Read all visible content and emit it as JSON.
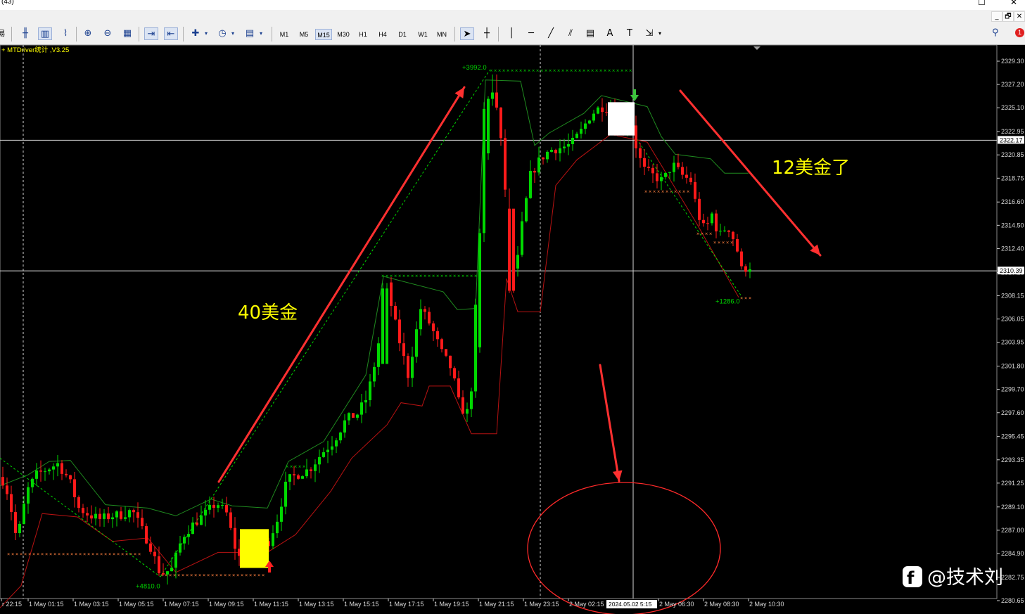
{
  "window": {
    "title": "(43)",
    "buttons": {
      "minimize": "–",
      "maximize": "☐",
      "close": "✕"
    }
  },
  "menubar": {
    "min_btn": "_",
    "restore_btn": "🗗",
    "close_btn": "✕",
    "left_glyph": "易"
  },
  "toolbar": {
    "icons": [
      {
        "name": "bar-chart-icon",
        "glyph": "╫"
      },
      {
        "name": "candlestick-icon",
        "glyph": "▥"
      },
      {
        "name": "line-chart-icon",
        "glyph": "⌇"
      },
      {
        "name": "zoom-in-icon",
        "glyph": "⊕"
      },
      {
        "name": "zoom-out-icon",
        "glyph": "⊖"
      },
      {
        "name": "tile-windows-icon",
        "glyph": "▦"
      },
      {
        "name": "auto-scroll-icon",
        "glyph": "⇥"
      },
      {
        "name": "chart-shift-icon",
        "glyph": "⇤"
      },
      {
        "name": "indicators-icon",
        "glyph": "✚"
      },
      {
        "name": "periods-clock-icon",
        "glyph": "◷"
      },
      {
        "name": "templates-icon",
        "glyph": "▤"
      }
    ],
    "timeframes": [
      "M1",
      "M5",
      "M15",
      "M30",
      "H1",
      "H4",
      "D1",
      "W1",
      "MN"
    ],
    "active_timeframe": "M15",
    "draw_tools": [
      {
        "name": "cursor-icon",
        "glyph": "➤"
      },
      {
        "name": "crosshair-icon",
        "glyph": "┼"
      },
      {
        "name": "vertical-line-icon",
        "glyph": "│"
      },
      {
        "name": "horizontal-line-icon",
        "glyph": "─"
      },
      {
        "name": "trendline-icon",
        "glyph": "╱"
      },
      {
        "name": "equidistant-channel-icon",
        "glyph": "⫽"
      },
      {
        "name": "fibonacci-icon",
        "glyph": "▤"
      },
      {
        "name": "text-icon",
        "glyph": "A"
      },
      {
        "name": "text-label-icon",
        "glyph": "T"
      },
      {
        "name": "arrows-icon",
        "glyph": "⇲"
      }
    ],
    "search_glyph": "⚲",
    "notification_count": "1"
  },
  "chart_data": {
    "type": "candlestick",
    "symbol_label": "MTDriver统计 ,V3.25",
    "y_axis": {
      "ticks": [
        "2329.30",
        "2327.20",
        "2325.10",
        "2322.95",
        "2320.85",
        "2318.75",
        "2316.60",
        "2314.50",
        "2312.40",
        "2310.25",
        "2308.15",
        "2306.05",
        "2303.95",
        "2301.80",
        "2299.70",
        "2297.60",
        "2295.45",
        "2293.35",
        "2291.25",
        "2289.10",
        "2287.00",
        "2284.90",
        "2282.75",
        "2280.65"
      ],
      "range": [
        2280.0,
        2330.0
      ],
      "current_price_labels": [
        "2322.17",
        "2310.39"
      ]
    },
    "x_axis": {
      "ticks": [
        "r 22:15",
        "1 May 01:15",
        "1 May 03:15",
        "1 May 05:15",
        "1 May 07:15",
        "1 May 09:15",
        "1 May 11:15",
        "1 May 13:15",
        "1 May 15:15",
        "1 May 17:15",
        "1 May 19:15",
        "1 May 21:15",
        "1 May 23:15",
        "2 May 02:15",
        "2 May 06:30",
        "2 May 08:30",
        "2 May 10:30"
      ],
      "crosshair_label": "2024.05.02 5:15"
    },
    "profit_labels": [
      "+3992.0",
      "+4810.0",
      "+1286.0"
    ],
    "annotations": [
      "40美金",
      "12美金了"
    ],
    "watermark": "@技术刘",
    "colors": {
      "bull": "#00d800",
      "bear": "#ff1a1a",
      "upper_band": "#1f8a1f",
      "lower_band": "#b81212",
      "arrow": "#ff3030",
      "label": "#ffff00"
    }
  }
}
